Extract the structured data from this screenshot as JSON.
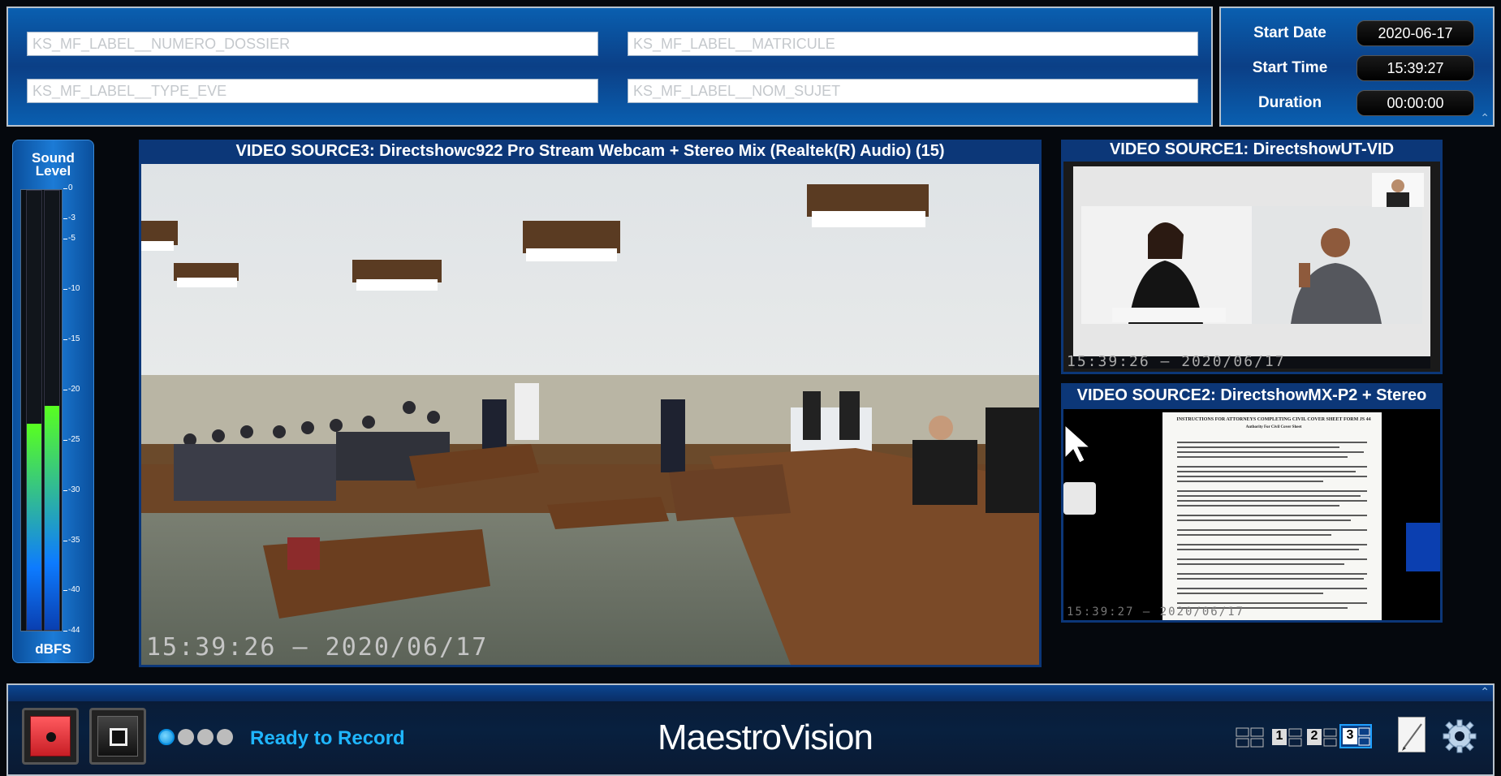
{
  "fields": {
    "numero_dossier": "KS_MF_LABEL__NUMERO_DOSSIER",
    "matricule": "KS_MF_LABEL__MATRICULE",
    "type_eve": "KS_MF_LABEL__TYPE_EVE",
    "nom_sujet": "KS_MF_LABEL__NOM_SUJET"
  },
  "session": {
    "start_date_label": "Start Date",
    "start_date": "2020-06-17",
    "start_time_label": "Start Time",
    "start_time": "15:39:27",
    "duration_label": "Duration",
    "duration": "00:00:00"
  },
  "sound_meter": {
    "title_line1": "Sound",
    "title_line2": "Level",
    "unit": "dBFS",
    "ticks": [
      "0",
      "-3",
      "-5",
      "-10",
      "-15",
      "-20",
      "-25",
      "-30",
      "-35",
      "-40",
      "-44"
    ],
    "left_level": 0.47,
    "right_level": 0.51
  },
  "videos": {
    "source3_title": "VIDEO SOURCE3: Directshowc922 Pro Stream Webcam + Stereo Mix (Realtek(R) Audio) (15)",
    "source3_overlay": "15:39:26 – 2020/06/17",
    "source1_title": "VIDEO SOURCE1: DirectshowUT-VID",
    "source1_overlay": "15:39:26 – 2020/06/17",
    "source2_title": "VIDEO SOURCE2: DirectshowMX-P2 + Stereo",
    "source2_overlay": "15:39:27 – 2020/06/17",
    "document_heading": "INSTRUCTIONS FOR ATTORNEYS COMPLETING CIVIL COVER SHEET FORM JS 44",
    "document_subheading": "Authority For Civil Cover Sheet"
  },
  "controls": {
    "status": "Ready to Record",
    "brand": "MaestroVision",
    "layout_1": "1",
    "layout_2": "2",
    "layout_3": "3"
  },
  "colors": {
    "panel_blue": "#0b3f86",
    "status_blue": "#1fb6ff",
    "record_red": "#e8343a",
    "meter_green": "#58ff20"
  }
}
